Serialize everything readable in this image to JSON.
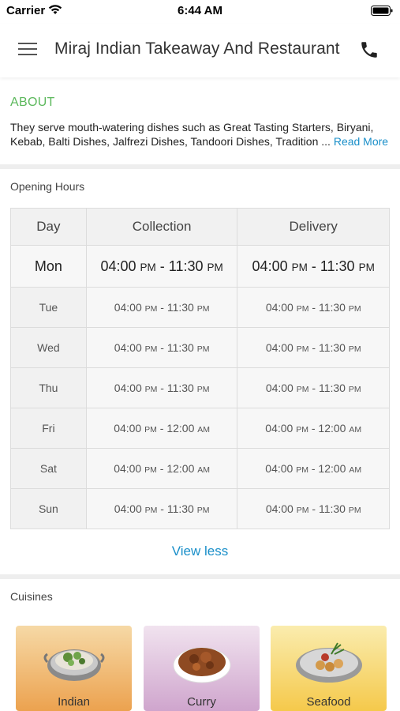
{
  "status_bar": {
    "carrier": "Carrier",
    "time": "6:44 AM"
  },
  "header": {
    "title": "Miraj Indian Takeaway And Restaurant",
    "icons": [
      "menu-icon",
      "phone-icon"
    ]
  },
  "about": {
    "title": "ABOUT",
    "text": "They serve mouth-watering dishes such as Great Tasting Starters, Biryani, Kebab, Balti Dishes, Jalfrezi Dishes, Tandoori Dishes, Tradition ...",
    "read_more": "Read More"
  },
  "opening_hours": {
    "label": "Opening Hours",
    "headers": {
      "day": "Day",
      "collection": "Collection",
      "delivery": "Delivery"
    },
    "rows": [
      {
        "day": "Mon",
        "col_start": "04:00",
        "col_start_ampm": "PM",
        "col_end": "11:30",
        "col_end_ampm": "PM",
        "del_start": "04:00",
        "del_start_ampm": "PM",
        "del_end": "11:30",
        "del_end_ampm": "PM"
      },
      {
        "day": "Tue",
        "col_start": "04:00",
        "col_start_ampm": "PM",
        "col_end": "11:30",
        "col_end_ampm": "PM",
        "del_start": "04:00",
        "del_start_ampm": "PM",
        "del_end": "11:30",
        "del_end_ampm": "PM"
      },
      {
        "day": "Wed",
        "col_start": "04:00",
        "col_start_ampm": "PM",
        "col_end": "11:30",
        "col_end_ampm": "PM",
        "del_start": "04:00",
        "del_start_ampm": "PM",
        "del_end": "11:30",
        "del_end_ampm": "PM"
      },
      {
        "day": "Thu",
        "col_start": "04:00",
        "col_start_ampm": "PM",
        "col_end": "11:30",
        "col_end_ampm": "PM",
        "del_start": "04:00",
        "del_start_ampm": "PM",
        "del_end": "11:30",
        "del_end_ampm": "PM"
      },
      {
        "day": "Fri",
        "col_start": "04:00",
        "col_start_ampm": "PM",
        "col_end": "12:00",
        "col_end_ampm": "AM",
        "del_start": "04:00",
        "del_start_ampm": "PM",
        "del_end": "12:00",
        "del_end_ampm": "AM"
      },
      {
        "day": "Sat",
        "col_start": "04:00",
        "col_start_ampm": "PM",
        "col_end": "12:00",
        "col_end_ampm": "AM",
        "del_start": "04:00",
        "del_start_ampm": "PM",
        "del_end": "12:00",
        "del_end_ampm": "AM"
      },
      {
        "day": "Sun",
        "col_start": "04:00",
        "col_start_ampm": "PM",
        "col_end": "11:30",
        "col_end_ampm": "PM",
        "del_start": "04:00",
        "del_start_ampm": "PM",
        "del_end": "11:30",
        "del_end_ampm": "PM"
      }
    ],
    "toggle_label": "View less"
  },
  "cuisines": {
    "label": "Cuisines",
    "items": [
      {
        "name": "Indian",
        "bg_top": "#f6d9a6",
        "bg_bottom": "#eca24f"
      },
      {
        "name": "Curry",
        "bg_top": "#f1e3ef",
        "bg_bottom": "#cfa5cd"
      },
      {
        "name": "Seafood",
        "bg_top": "#faecae",
        "bg_bottom": "#f5c94b"
      }
    ]
  },
  "colors": {
    "accent_green": "#5cb85c",
    "link_blue": "#1a8fc9",
    "divider": "#eeeeee"
  }
}
